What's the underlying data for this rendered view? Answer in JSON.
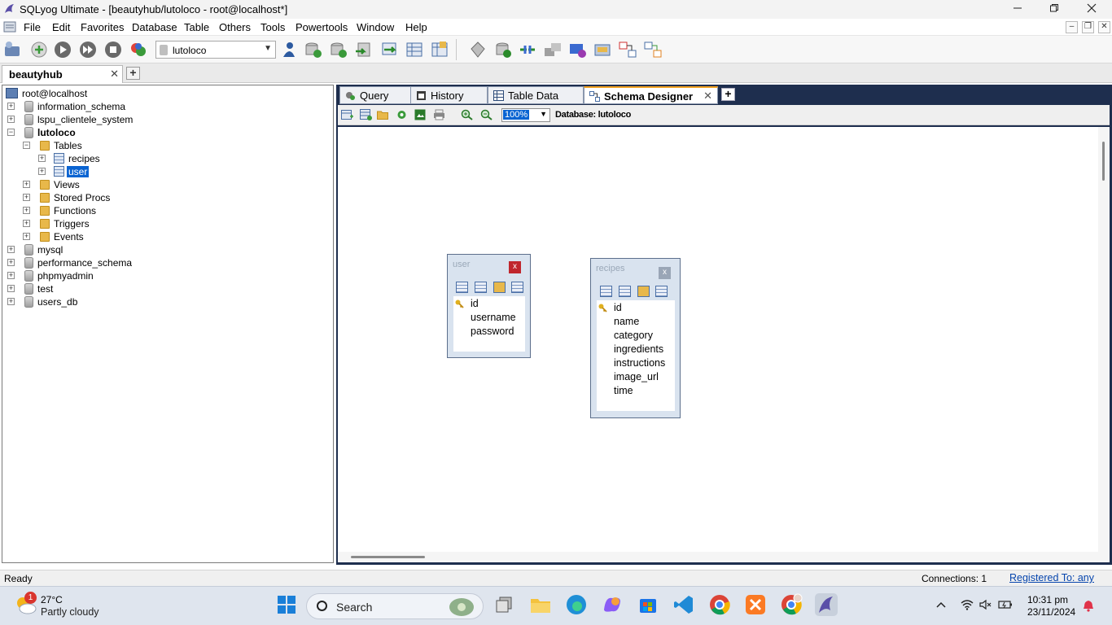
{
  "window": {
    "title": "SQLyog Ultimate - [beautyhub/lutoloco - root@localhost*]",
    "minimize_icon": "minimize-icon",
    "maximize_icon": "restore-icon",
    "close_icon": "close-icon"
  },
  "menu": {
    "items": [
      "File",
      "Edit",
      "Favorites",
      "Database",
      "Table",
      "Others",
      "Tools",
      "Powertools",
      "Window",
      "Help"
    ]
  },
  "toolbar": {
    "database_selector": "lutoloco"
  },
  "connection_tab": {
    "label": "beautyhub",
    "close": "✕",
    "add": "+"
  },
  "object_browser": {
    "root": "root@localhost",
    "databases": [
      "information_schema",
      "lspu_clientele_system",
      "lutoloco",
      "mysql",
      "performance_schema",
      "phpmyadmin",
      "test",
      "users_db"
    ],
    "expanded_db": "lutoloco",
    "folders": [
      "Tables",
      "Views",
      "Stored Procs",
      "Functions",
      "Triggers",
      "Events"
    ],
    "tables": [
      "recipes",
      "user"
    ],
    "selected_table": "user"
  },
  "query_tabs": {
    "items": [
      {
        "label": "Query",
        "icon": "query-icon"
      },
      {
        "label": "History",
        "icon": "history-icon"
      },
      {
        "label": "Table Data",
        "icon": "table-data-icon"
      },
      {
        "label": "Schema Designer",
        "icon": "schema-designer-icon",
        "active": true
      }
    ],
    "close": "✕",
    "add": "+"
  },
  "designer": {
    "zoom": "100%",
    "database_label": "Database: lutoloco"
  },
  "entities": [
    {
      "name": "user",
      "close": "x",
      "columns": [
        "id",
        "username",
        "password"
      ],
      "primary_key": "id"
    },
    {
      "name": "recipes",
      "close": "x",
      "columns": [
        "id",
        "name",
        "category",
        "ingredients",
        "instructions",
        "image_url",
        "time"
      ],
      "primary_key": "id"
    }
  ],
  "status": {
    "ready": "Ready",
    "connections": "Connections: 1",
    "registered": "Registered To: any"
  },
  "taskbar": {
    "weather_temp": "27°C",
    "weather_desc": "Partly cloudy",
    "weather_badge": "1",
    "search_label": "Search",
    "time": "10:31 pm",
    "date": "23/11/2024"
  }
}
